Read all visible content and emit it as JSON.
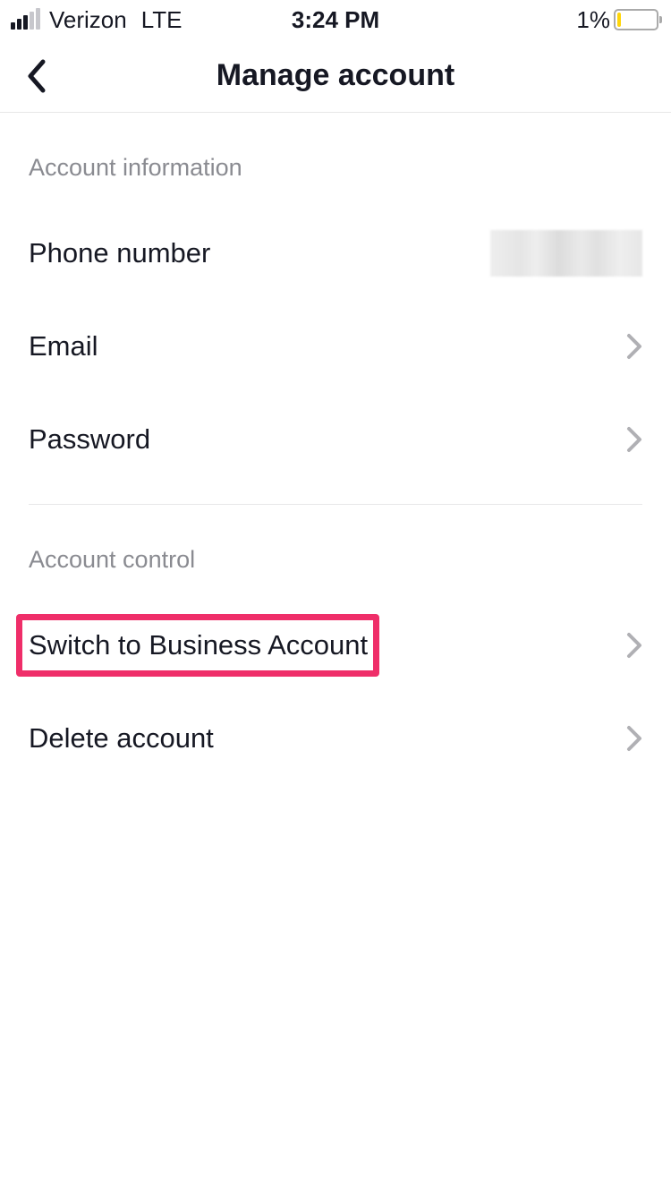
{
  "status": {
    "carrier": "Verizon",
    "network": "LTE",
    "time": "3:24 PM",
    "battery_pct": "1%"
  },
  "header": {
    "title": "Manage account"
  },
  "sections": {
    "info": {
      "title": "Account information",
      "phone_label": "Phone number",
      "email_label": "Email",
      "password_label": "Password"
    },
    "control": {
      "title": "Account control",
      "switch_label": "Switch to Business Account",
      "delete_label": "Delete account"
    }
  }
}
